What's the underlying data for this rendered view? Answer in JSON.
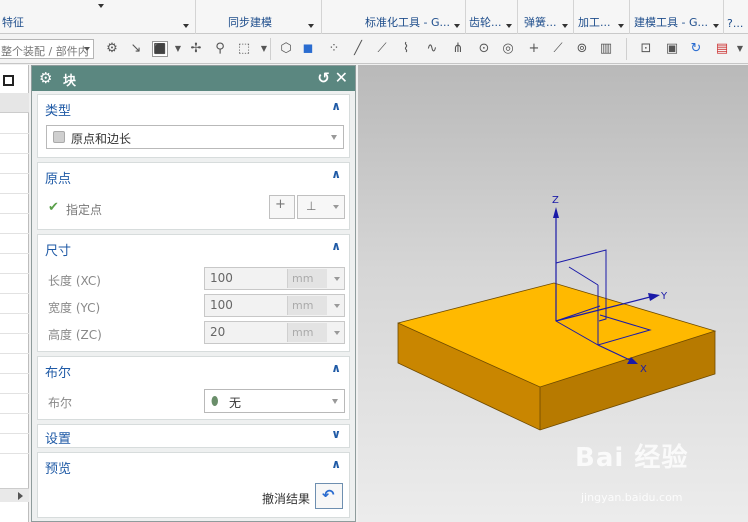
{
  "ribbon": {
    "groups": [
      {
        "label": "特征"
      },
      {
        "label": "同步建模"
      },
      {
        "label": "标准化工具 - G..."
      },
      {
        "label": "齿轮..."
      },
      {
        "label": "弹簧..."
      },
      {
        "label": "加工..."
      },
      {
        "label": "建模工具 - G..."
      },
      {
        "label": "?..."
      }
    ]
  },
  "toolbar": {
    "part_filter": "整个装配 / 部件内"
  },
  "dialog": {
    "title": "块",
    "sections": {
      "type": {
        "label": "类型",
        "selected": "原点和边长"
      },
      "origin": {
        "label": "原点",
        "specify_point": "指定点"
      },
      "dimensions": {
        "label": "尺寸",
        "length_label": "长度 (XC)",
        "length_value": "100",
        "width_label": "宽度 (YC)",
        "width_value": "100",
        "height_label": "高度 (ZC)",
        "height_value": "20",
        "unit": "mm"
      },
      "boolean": {
        "label": "布尔",
        "row_label": "布尔",
        "value": "无"
      },
      "settings": {
        "label": "设置"
      },
      "preview": {
        "label": "预览",
        "undo_label": "撤消结果"
      }
    }
  },
  "viewport": {
    "axes": {
      "x": "X",
      "y": "Y",
      "z": "Z"
    },
    "colors": {
      "block_top": "#FFB900",
      "block_front": "#C98600",
      "block_right": "#B77A00",
      "axis": "#1a1aa8"
    }
  },
  "watermark": {
    "main": "Bai  经验",
    "sub": "jingyan.baidu.com"
  }
}
